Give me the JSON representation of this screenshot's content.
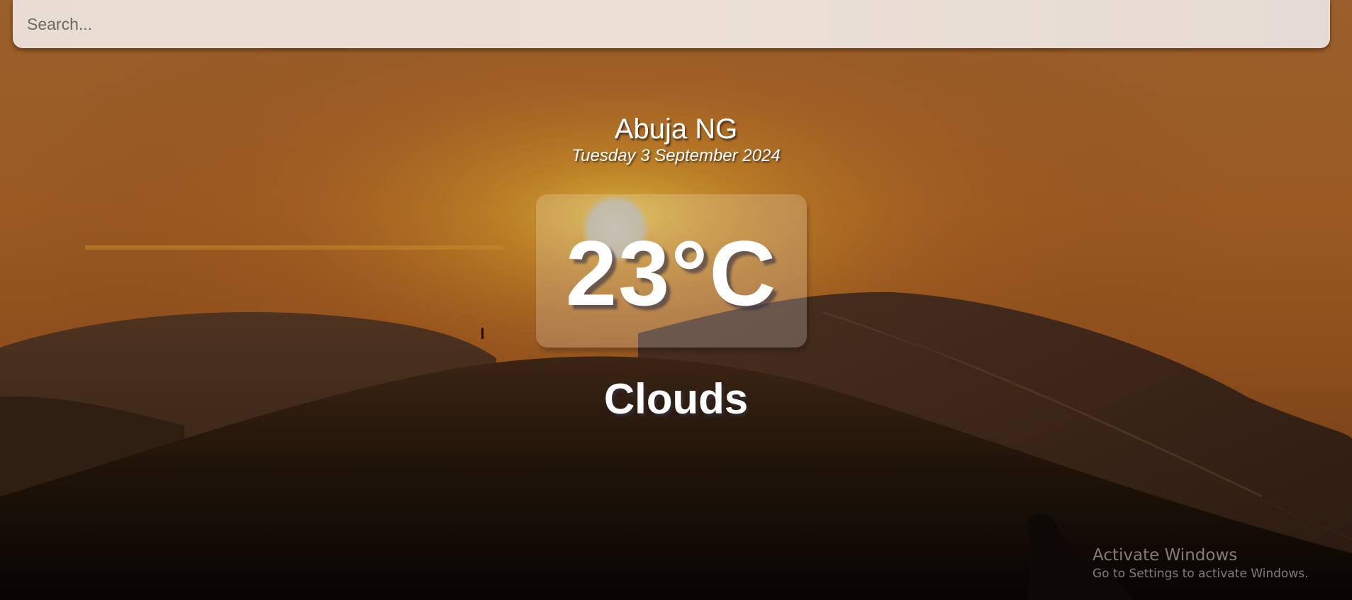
{
  "search": {
    "placeholder": "Search..."
  },
  "location": {
    "name": "Abuja NG",
    "date": "Tuesday 3 September 2024"
  },
  "weather": {
    "temperature": "23°C",
    "condition": "Clouds"
  },
  "overlay": {
    "activate_title": "Activate Windows",
    "activate_subtitle": "Go to Settings to activate Windows."
  },
  "colors": {
    "sky_top": "#a4692e",
    "sky_glow": "#c8902a",
    "dune_dark": "#140c06",
    "text": "#ffffff"
  },
  "background": {
    "scene": "desert-sunset-icon"
  }
}
